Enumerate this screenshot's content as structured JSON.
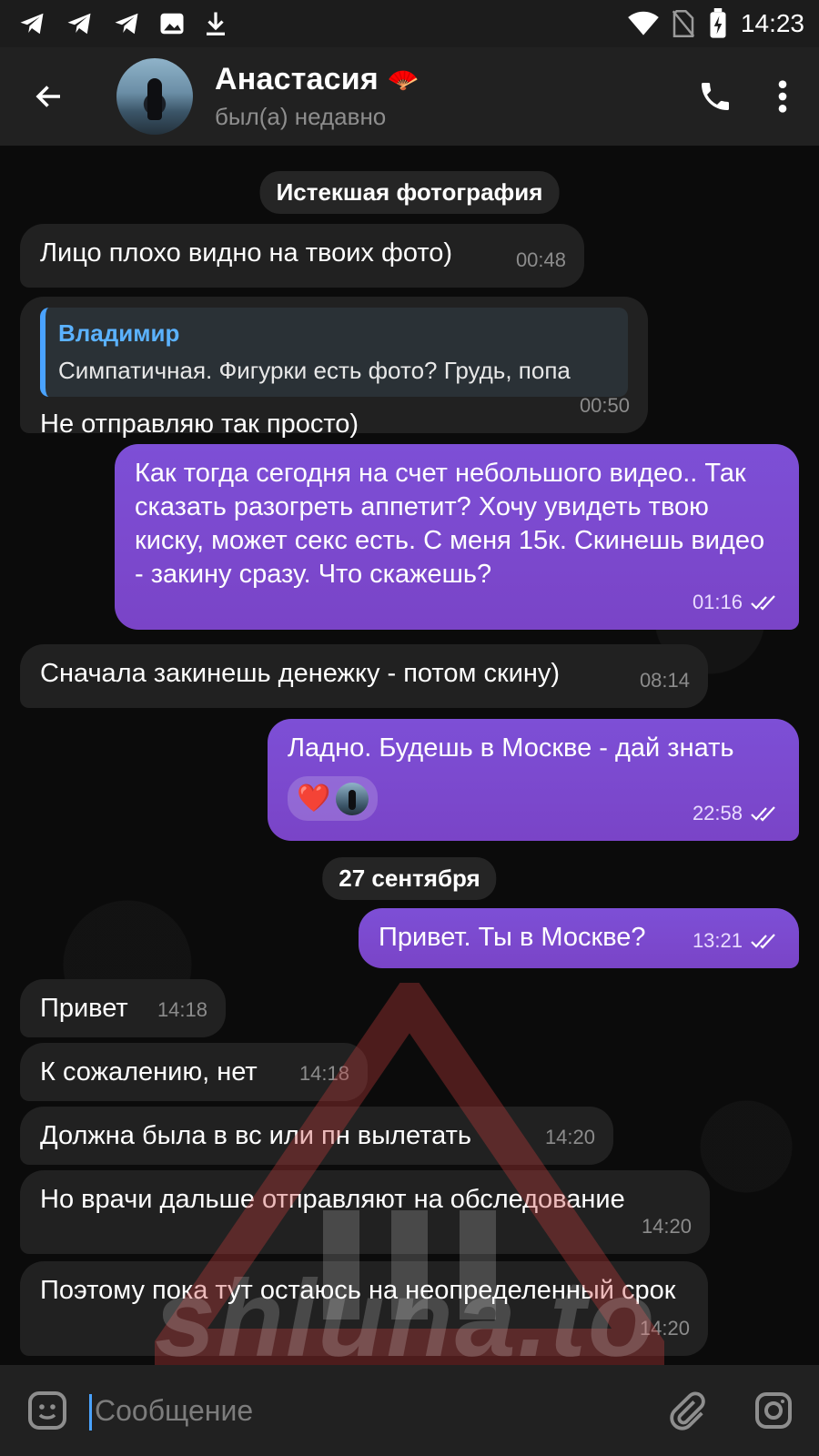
{
  "status_bar": {
    "time": "14:23",
    "icons": [
      "telegram-icon",
      "telegram-icon",
      "telegram-icon",
      "image-icon",
      "download-icon",
      "wifi-icon",
      "no-sim-icon",
      "battery-charging-icon"
    ]
  },
  "header": {
    "name": "Анастасия",
    "status": "был(а) недавно",
    "emoji": "🪭"
  },
  "chat": {
    "system_1": "Истекшая фотография",
    "date_1": "27 сентября",
    "messages": [
      {
        "side": "in",
        "text": "Лицо плохо видно на твоих фото)",
        "time": "00:48"
      },
      {
        "side": "in",
        "reply_name": "Владимир",
        "reply_text": "Симпатичная. Фигурки есть фото? Грудь, попа",
        "text": "Не отправляю так просто)",
        "time": "00:50"
      },
      {
        "side": "out",
        "text": "Как тогда сегодня на счет небольшого видео.. Так сказать разогреть аппетит? Хочу увидеть твою киску, может секс есть. С меня 15к. Скинешь видео - закину сразу. Что скажешь?",
        "time": "01:16"
      },
      {
        "side": "in",
        "text": "Сначала закинешь денежку - потом скину)",
        "time": "08:14"
      },
      {
        "side": "out",
        "text": "Ладно. Будешь в Москве - дай знать",
        "time": "22:58",
        "reaction": "❤️"
      },
      {
        "side": "out",
        "text": "Привет. Ты в Москве?",
        "time": "13:21"
      },
      {
        "side": "in",
        "text": "Привет",
        "time": "14:18"
      },
      {
        "side": "in",
        "text": "К сожалению, нет",
        "time": "14:18"
      },
      {
        "side": "in",
        "text": "Должна была в вс или пн вылетать",
        "time": "14:20"
      },
      {
        "side": "in",
        "text": "Но врачи дальше отправляют на обследование",
        "time": "14:20"
      },
      {
        "side": "in",
        "text": "Поэтому пока тут остаюсь на неопределенный срок",
        "time": "14:20"
      }
    ]
  },
  "watermark": {
    "text": "shluna.to"
  },
  "composer": {
    "placeholder": "Сообщение"
  }
}
